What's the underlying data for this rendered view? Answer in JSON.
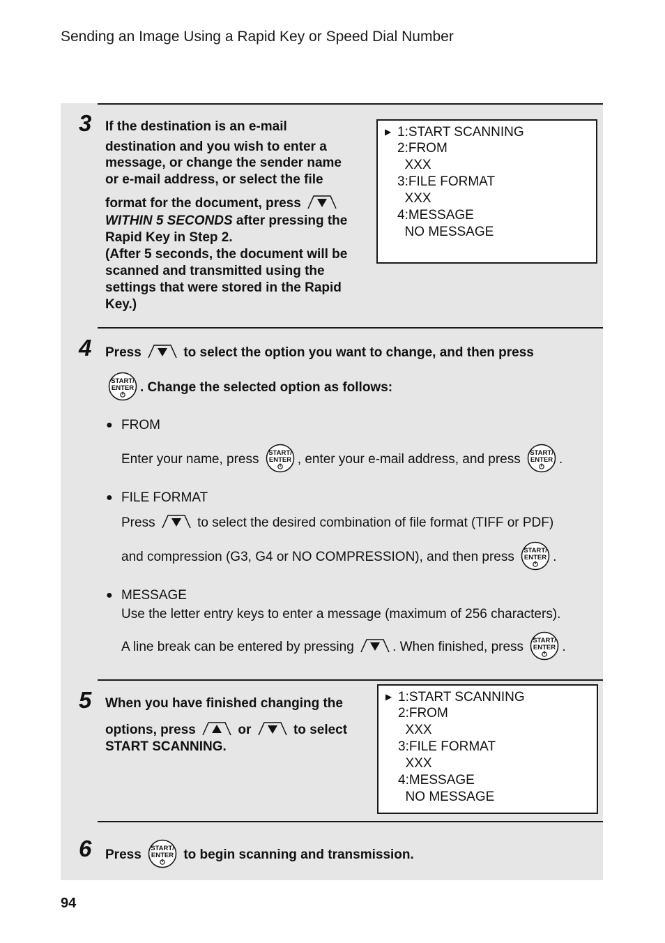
{
  "header": {
    "title": "Sending an Image Using a Rapid Key or Speed Dial Number"
  },
  "steps": [
    {
      "number": "3",
      "lines": [
        "If the destination is an e-mail",
        "destination and you wish to enter a",
        "message, or change the sender name",
        "or e-mail address, or select the file",
        "format for the document, press",
        "WITHIN 5 SECONDS",
        " after pressing the",
        "Rapid Key in Step 2.",
        "(After 5 seconds, the document will be",
        "scanned and transmitted using the",
        "settings that were stored in the Rapid",
        "Key.)"
      ],
      "display": [
        "1:START SCANNING",
        "2:FROM",
        "  XXX",
        "3:FILE FORMAT",
        "  XXX",
        "4:MESSAGE",
        "  NO MESSAGE"
      ]
    },
    {
      "number": "4",
      "line1_a": "Press",
      "line1_b": "to select the option you want to change, and then press",
      "line2": ". Change the selected option as follows:",
      "options": [
        {
          "title": "FROM",
          "text_a": "Enter your name, press",
          "text_b": ", enter your e-mail address, and press",
          "text_c": "."
        },
        {
          "title": "FILE FORMAT",
          "text_a": "Press",
          "text_b": "to select the desired combination of file format (TIFF or PDF)",
          "text_c": "and compression (G3, G4 or NO COMPRESSION), and then press",
          "text_d": "."
        },
        {
          "title": "MESSAGE",
          "text_a": "Use the letter entry keys to enter a message (maximum of 256 characters).",
          "text_b": "A line break can be entered by pressing",
          "text_c": ". When finished, press",
          "text_d": "."
        }
      ]
    },
    {
      "number": "5",
      "line1": "When you have finished changing the",
      "line2_a": "options, press",
      "line2_b": "or",
      "line2_c": "to select",
      "line3": "START SCANNING.",
      "display": [
        "1:START SCANNING",
        "2:FROM",
        "  XXX",
        "3:FILE FORMAT",
        "  XXX",
        "4:MESSAGE",
        "  NO MESSAGE"
      ]
    },
    {
      "number": "6",
      "text_a": "Press",
      "text_b": "to begin scanning and transmission."
    }
  ],
  "keys": {
    "start_top": "START/",
    "start_bottom": "ENTER"
  },
  "display_cursor": "▶",
  "page_number": "94"
}
